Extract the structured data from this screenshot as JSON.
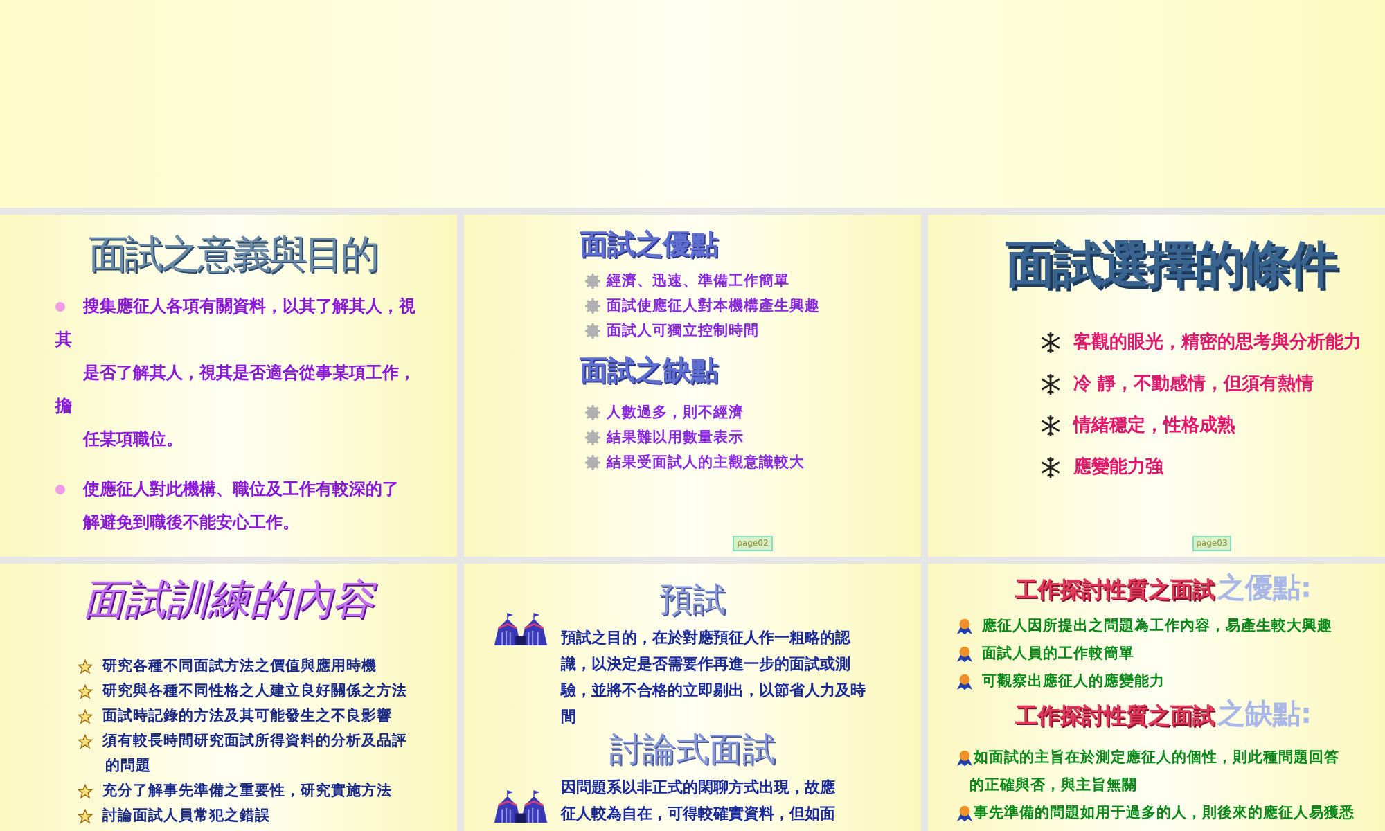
{
  "slides": [
    {
      "kind": "meaning",
      "sections": [
        {
          "heading": "面試之意義與目的",
          "items": [
            {
              "lines": [
                {
                  "text": "搜集應征人各項有關資料，以其了解其人，視",
                  "indent": false
                },
                {
                  "text": "其",
                  "indent": false
                },
                {
                  "text": "是否了解其人，視其是否適合從事某項工作，",
                  "indent": true
                },
                {
                  "text": "擔",
                  "indent": false
                },
                {
                  "text": "任某項職位。",
                  "indent": true
                }
              ]
            },
            {
              "lines": [
                {
                  "text": "使應征人對此機構、職位及工作有較深的了",
                  "indent": false
                },
                {
                  "text": "解避免到職後不能安心工作。",
                  "indent": true
                }
              ]
            }
          ]
        }
      ]
    },
    {
      "kind": "proscons",
      "page": "page02",
      "sections": [
        {
          "heading": "面試之優點",
          "items": [
            {
              "lines": [
                {
                  "text": "經濟、迅速、準備工作簡單",
                  "indent": false
                }
              ]
            },
            {
              "lines": [
                {
                  "text": "面試使應征人對本機構產生興趣",
                  "indent": false
                }
              ]
            },
            {
              "lines": [
                {
                  "text": "面試人可獨立控制時間",
                  "indent": false
                }
              ]
            }
          ]
        },
        {
          "heading": "面試之缺點",
          "items": [
            {
              "lines": [
                {
                  "text": "人數過多，則不經濟",
                  "indent": false
                }
              ]
            },
            {
              "lines": [
                {
                  "text": "結果難以用數量表示",
                  "indent": false
                }
              ]
            },
            {
              "lines": [
                {
                  "text": "結果受面試人的主觀意識較大",
                  "indent": false
                }
              ]
            }
          ]
        }
      ]
    },
    {
      "kind": "conditions",
      "page": "page03",
      "sections": [
        {
          "heading": "面試選擇的條件",
          "items": [
            {
              "lines": [
                {
                  "text": "客觀的眼光，精密的思考與分析能力",
                  "indent": false
                }
              ]
            },
            {
              "lines": [
                {
                  "text": "冷 靜，不動感情，但須有熱情",
                  "indent": false
                }
              ]
            },
            {
              "lines": [
                {
                  "text": "情緒穩定，性格成熟",
                  "indent": false
                }
              ]
            },
            {
              "lines": [
                {
                  "text": "應變能力強",
                  "indent": false
                }
              ]
            }
          ]
        }
      ]
    },
    {
      "kind": "training",
      "sections": [
        {
          "heading": "面試訓練的內容",
          "items": [
            {
              "lines": [
                {
                  "text": "研究各種不同面試方法之價值與應用時機",
                  "indent": false
                }
              ]
            },
            {
              "lines": [
                {
                  "text": "研究與各種不同性格之人建立良好關係之方法",
                  "indent": false
                }
              ]
            },
            {
              "lines": [
                {
                  "text": "面試時記錄的方法及其可能發生之不良影響",
                  "indent": false
                }
              ]
            },
            {
              "lines": [
                {
                  "text": "須有較長時間研究面試所得資料的分析及品評",
                  "indent": false
                },
                {
                  "text": "的問題",
                  "indent": true
                }
              ]
            },
            {
              "lines": [
                {
                  "text": "充分了解事先準備之重要性，研究實施方法",
                  "indent": false
                }
              ]
            },
            {
              "lines": [
                {
                  "text": "討論面試人員常犯之錯誤",
                  "indent": false
                }
              ]
            }
          ]
        }
      ]
    },
    {
      "kind": "pretest",
      "sections": [
        {
          "heading": "預試",
          "items": [
            {
              "lines": [
                {
                  "text": "預試之目的，在於對應預征人作一粗略的認",
                  "indent": false
                },
                {
                  "text": "識，以決定是否需要作再進一步的面試或測",
                  "indent": true
                },
                {
                  "text": "驗，並將不合格的立即剔出，以節省人力及時",
                  "indent": true
                },
                {
                  "text": "間",
                  "indent": true
                }
              ]
            }
          ]
        },
        {
          "heading": "討論式面試",
          "items": [
            {
              "lines": [
                {
                  "text": "因問題系以非正式的閑聊方式出現，故應",
                  "indent": false
                },
                {
                  "text": "征人較為自在，可得較確實資料，但如面",
                  "indent": true
                }
              ]
            }
          ]
        }
      ]
    },
    {
      "kind": "jobtalk",
      "sections": [
        {
          "heading": "工作探討性質之面試",
          "tag": "之優點:",
          "items": [
            {
              "lines": [
                {
                  "text": "應征人因所提出之問題為工作內容，易產生較大興趣",
                  "indent": false
                }
              ]
            },
            {
              "lines": [
                {
                  "text": "面試人員的工作較簡單",
                  "indent": false
                }
              ]
            },
            {
              "lines": [
                {
                  "text": "可觀察出應征人的應變能力",
                  "indent": false
                }
              ]
            }
          ]
        },
        {
          "heading": "工作探討性質之面試",
          "tag": "之缺點:",
          "items": [
            {
              "lines": [
                {
                  "text": "如面試的主旨在於測定應征人的個性，則此種問題回答",
                  "indent": false
                },
                {
                  "text": "的正確與否，與主旨無關",
                  "indent": true
                }
              ]
            },
            {
              "lines": [
                {
                  "text": "事先準備的問題如用于過多的人，則後來的應征人易獲悉",
                  "indent": false
                }
              ]
            }
          ]
        }
      ]
    }
  ]
}
